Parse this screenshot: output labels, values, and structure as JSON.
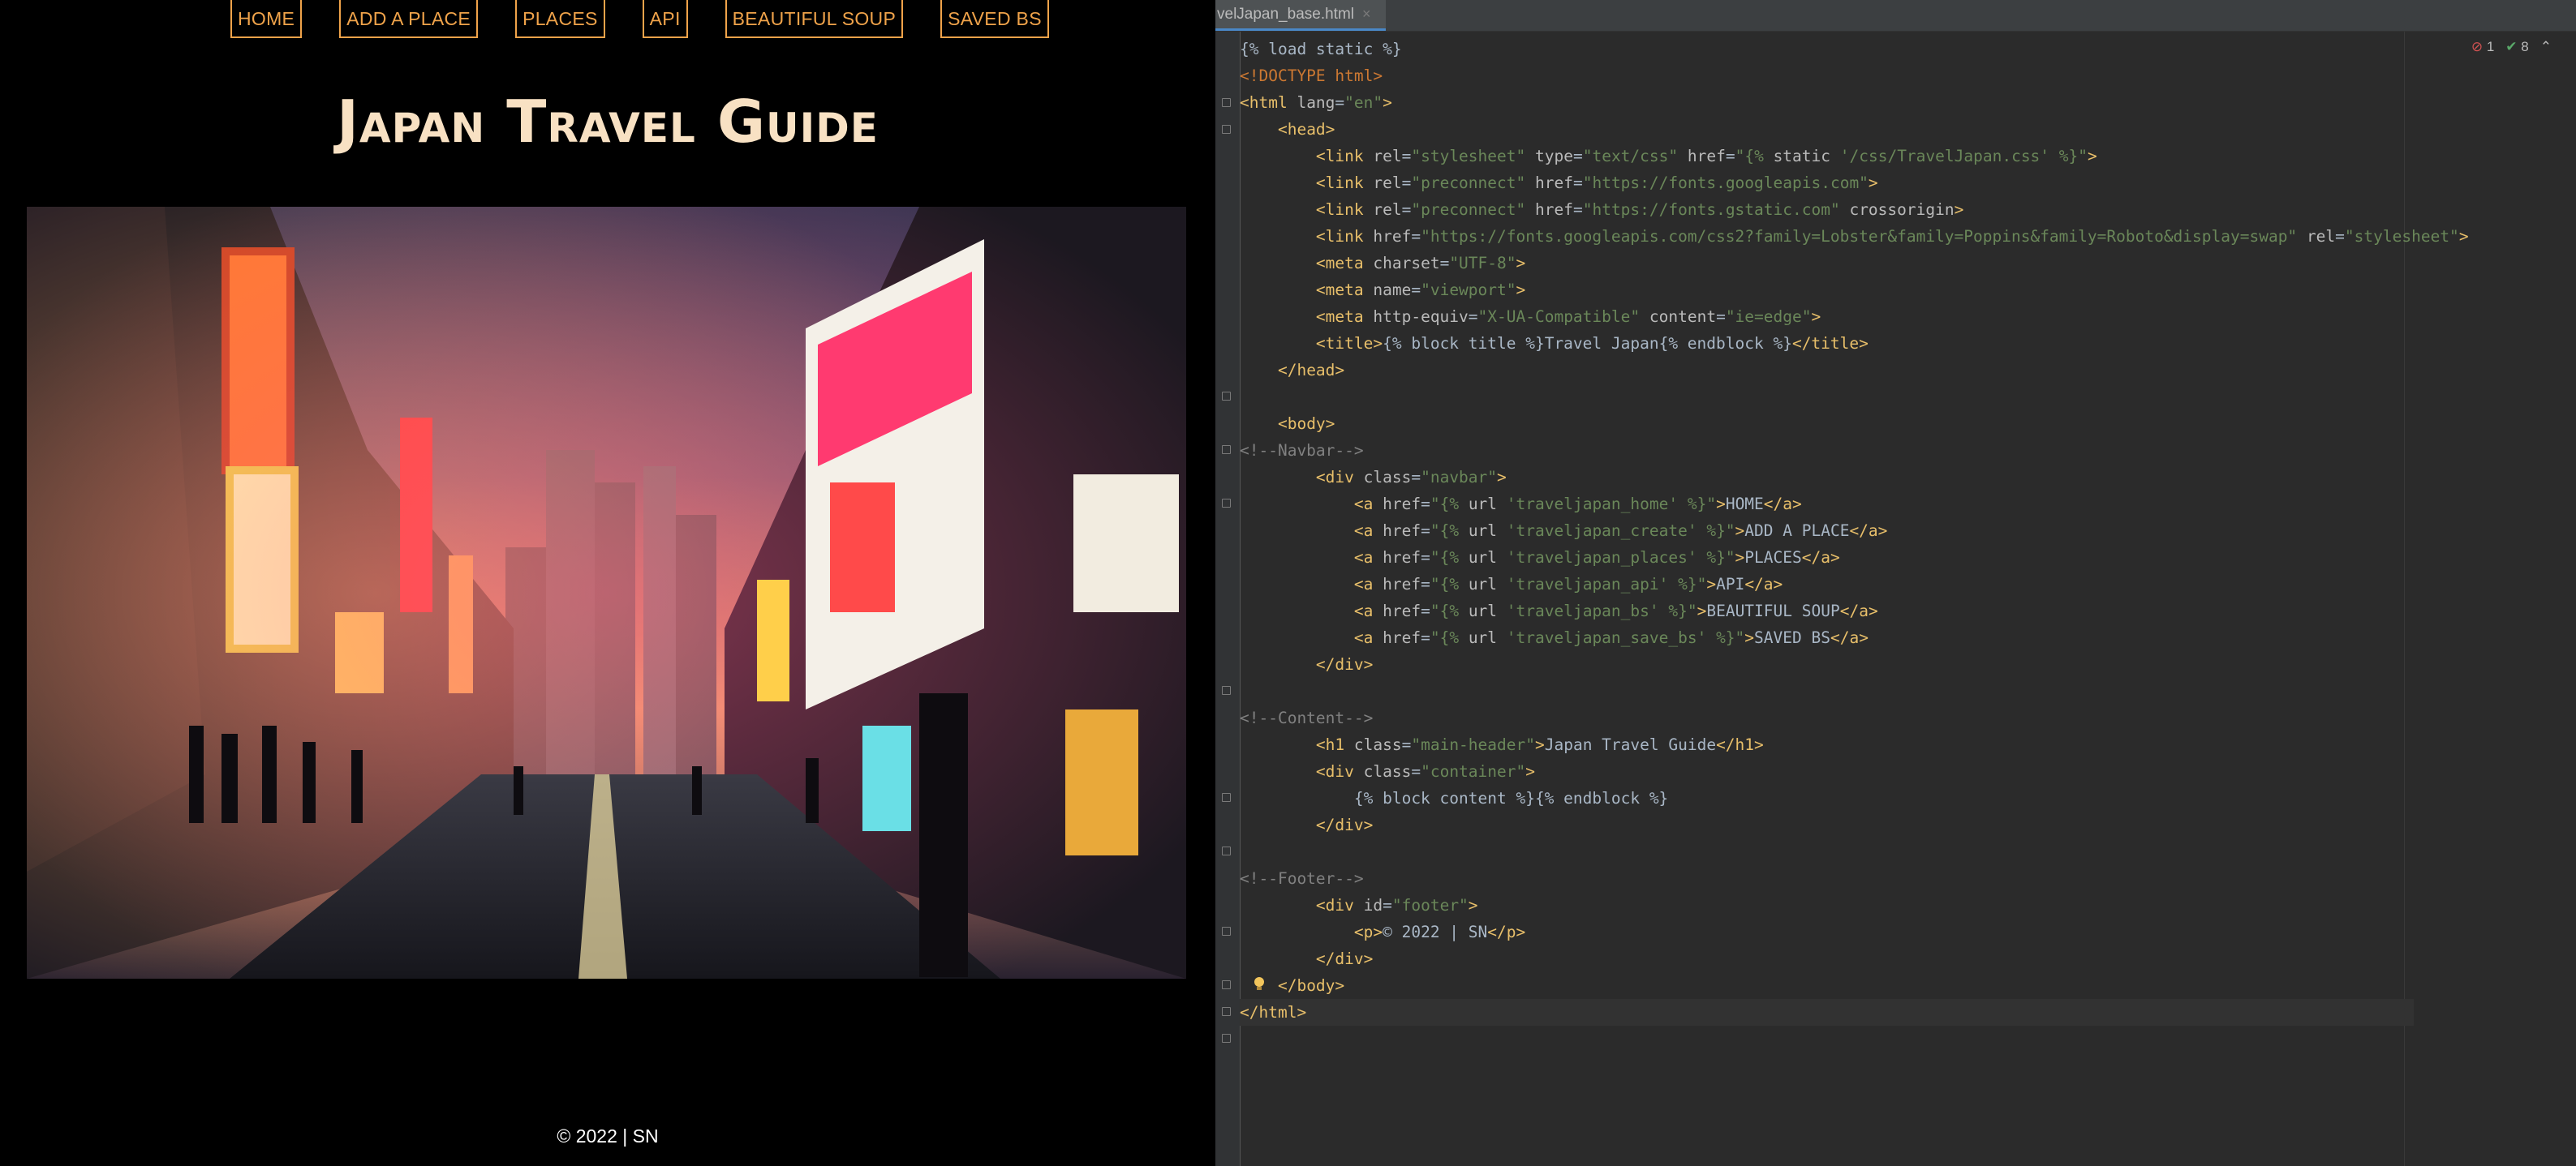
{
  "browser": {
    "nav": [
      {
        "label": "HOME"
      },
      {
        "label": "ADD A PLACE"
      },
      {
        "label": "PLACES"
      },
      {
        "label": "API"
      },
      {
        "label": "BEAUTIFUL SOUP"
      },
      {
        "label": "SAVED BS"
      }
    ],
    "title": "Japan Travel Guide",
    "footer": "© 2022 | SN"
  },
  "ide": {
    "tab_label": "velJapan_base.html",
    "tab_close": "×",
    "inspections": {
      "errors": "1",
      "warnings": "8"
    },
    "code_lines": [
      "{% load static %}",
      "<!DOCTYPE html>",
      "<html lang=\"en\">",
      "    <head>",
      "        <link rel=\"stylesheet\" type=\"text/css\" href=\"{% static '/css/TravelJapan.css' %}\">",
      "        <link rel=\"preconnect\" href=\"https://fonts.googleapis.com\">",
      "        <link rel=\"preconnect\" href=\"https://fonts.gstatic.com\" crossorigin>",
      "        <link href=\"https://fonts.googleapis.com/css2?family=Lobster&family=Poppins&family=Roboto&display=swap\" rel=\"stylesheet\">",
      "        <meta charset=\"UTF-8\">",
      "        <meta name=\"viewport\">",
      "        <meta http-equiv=\"X-UA-Compatible\" content=\"ie=edge\">",
      "        <title>{% block title %}Travel Japan{% endblock %}</title>",
      "    </head>",
      "",
      "    <body>",
      "<!--Navbar-->",
      "        <div class=\"navbar\">",
      "            <a href=\"{% url 'traveljapan_home' %}\">HOME</a>",
      "            <a href=\"{% url 'traveljapan_create' %}\">ADD A PLACE</a>",
      "            <a href=\"{% url 'traveljapan_places' %}\">PLACES</a>",
      "            <a href=\"{% url 'traveljapan_api' %}\">API</a>",
      "            <a href=\"{% url 'traveljapan_bs' %}\">BEAUTIFUL SOUP</a>",
      "            <a href=\"{% url 'traveljapan_save_bs' %}\">SAVED BS</a>",
      "        </div>",
      "",
      "<!--Content-->",
      "        <h1 class=\"main-header\">Japan Travel Guide</h1>",
      "        <div class=\"container\">",
      "            {% block content %}{% endblock %}",
      "        </div>",
      "",
      "<!--Footer-->",
      "        <div id=\"footer\">",
      "            <p>© 2022 | SN</p>",
      "        </div>",
      "    </body>",
      "</html>"
    ]
  },
  "colors": {
    "nav": "#f0a34a",
    "title": "#f8e1c3",
    "ide_bg": "#2b2b2b"
  }
}
